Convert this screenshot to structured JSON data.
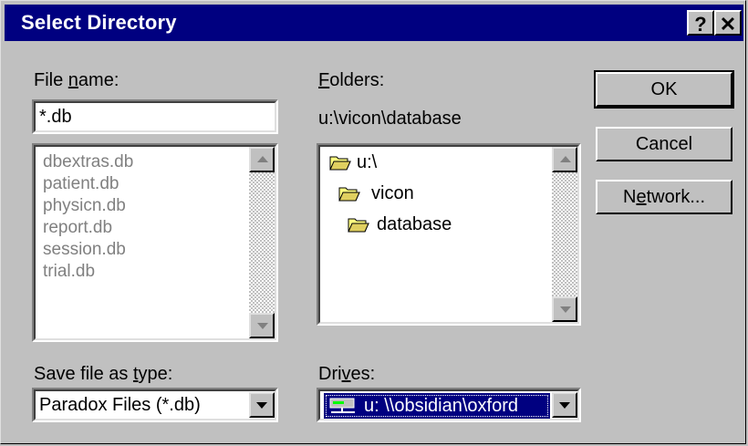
{
  "dialog": {
    "title": "Select Directory",
    "help_button": "?",
    "close_button": "✕"
  },
  "file_name": {
    "label_pre": "File ",
    "label_u": "n",
    "label_post": "ame:",
    "value": "*.db"
  },
  "files": [
    "dbextras.db",
    "patient.db",
    "physicn.db",
    "report.db",
    "session.db",
    "trial.db"
  ],
  "folders": {
    "label_u": "F",
    "label_post": "olders:",
    "current_path": "u:\\vicon\\database",
    "items": [
      "u:\\",
      "vicon",
      "database"
    ]
  },
  "buttons": {
    "ok": "OK",
    "cancel": "Cancel",
    "network_pre": "N",
    "network_u": "e",
    "network_post": "twork..."
  },
  "save_type": {
    "label_pre": "Save file as ",
    "label_u": "t",
    "label_post": "ype:",
    "value": "Paradox Files (*.db)"
  },
  "drives": {
    "label_pre": "Dri",
    "label_u": "v",
    "label_post": "es:",
    "value": "u: \\\\obsidian\\oxford"
  },
  "colors": {
    "title_bar": "#000080",
    "face": "#c0c0c0",
    "selection": "#000080"
  }
}
